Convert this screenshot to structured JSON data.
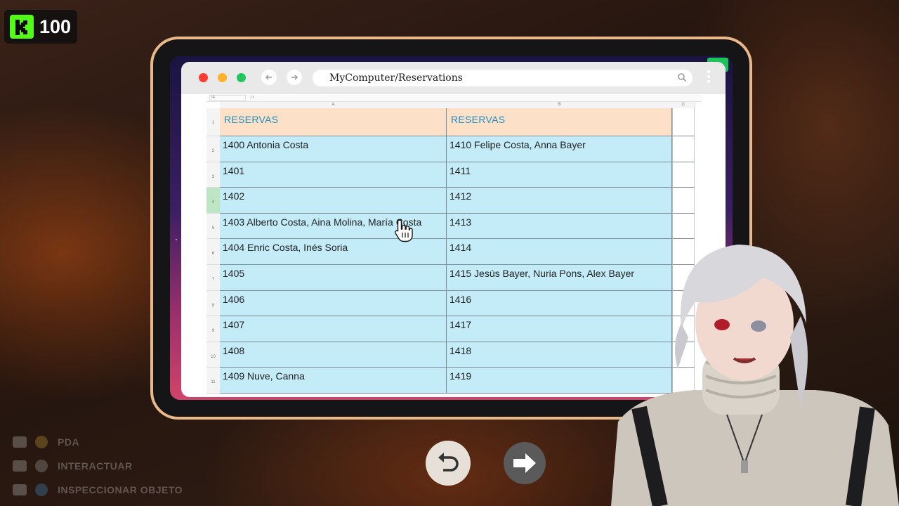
{
  "overlay": {
    "points": "100",
    "logo_icon": "kick-logo-icon",
    "logo_color": "#53fc18"
  },
  "browser": {
    "url": "MyComputer/Reservations",
    "buttons": [
      "back-arrow-icon",
      "forward-arrow-icon",
      "search-icon",
      "more-vert-icon"
    ]
  },
  "sheet": {
    "cell_ref": "I4",
    "column_letters": [
      "A",
      "B",
      "C"
    ],
    "row_numbers": [
      "1",
      "2",
      "3",
      "4",
      "5",
      "6",
      "7",
      "8",
      "9",
      "10",
      "11"
    ],
    "header_a": "RESERVAS",
    "header_b": "RESERVAS",
    "rows": [
      {
        "a": "1400   Antonia Costa",
        "b": "1410   Felipe Costa, Anna Bayer"
      },
      {
        "a": "1401",
        "b": "1411"
      },
      {
        "a": "1402",
        "b": "1412"
      },
      {
        "a": "1403   Alberto Costa, Aina Molina, María Costa",
        "b": "1413"
      },
      {
        "a": "1404   Enric Costa, Inés Soria",
        "b": "1414"
      },
      {
        "a": "1405",
        "b": "1415   Jesús Bayer, Nuria Pons, Alex Bayer"
      },
      {
        "a": "1406",
        "b": "1416"
      },
      {
        "a": "1407",
        "b": "1417"
      },
      {
        "a": "1408",
        "b": "1418"
      },
      {
        "a": "1409   Nuve, Canna",
        "b": "1419"
      }
    ],
    "colors": {
      "header_bg": "#fde0c8",
      "header_text": "#1e8fbf",
      "cell_bg": "#c3ecf8"
    }
  },
  "controls": {
    "undo_icon": "undo-arrow-icon",
    "next_icon": "right-arrow-icon"
  },
  "hints": [
    {
      "label": "PDA"
    },
    {
      "label": "INTERACTUAR"
    },
    {
      "label": "INSPECCIONAR OBJETO"
    }
  ]
}
